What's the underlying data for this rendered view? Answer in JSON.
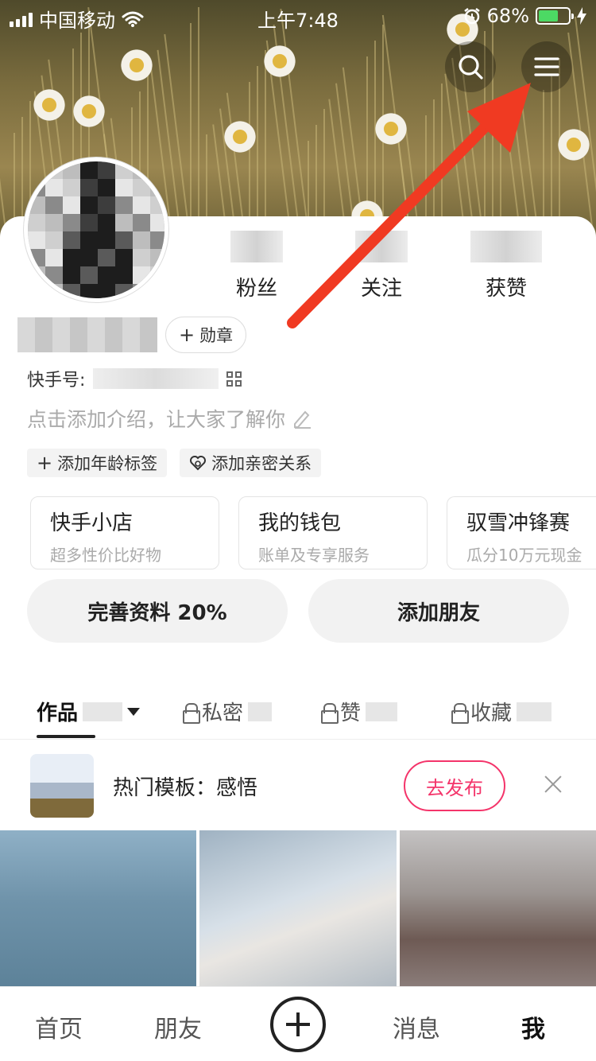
{
  "status_bar": {
    "carrier": "中国移动",
    "time": "上午7:48",
    "battery": "68%",
    "battery_level": 0.68,
    "alarm_icon": "alarm-clock-icon",
    "wifi_icon": "wifi-icon",
    "charging_icon": "charging-bolt-icon"
  },
  "header": {
    "search_icon": "search-icon",
    "menu_icon": "hamburger-menu-icon"
  },
  "stats": [
    {
      "label": "粉丝"
    },
    {
      "label": "关注"
    },
    {
      "label": "获赞"
    }
  ],
  "profile": {
    "medal_label": "勋章",
    "kuaishou_id_label": "快手号:",
    "intro_placeholder": "点击添加介绍，让大家了解你",
    "tags": [
      "添加年龄标签",
      "添加亲密关系"
    ]
  },
  "services": [
    {
      "title": "快手小店",
      "subtitle": "超多性价比好物"
    },
    {
      "title": "我的钱包",
      "subtitle": "账单及专享服务"
    },
    {
      "title": "驭雪冲锋赛",
      "subtitle": "瓜分10万元现金"
    }
  ],
  "actions": {
    "complete_profile": "完善资料 20%",
    "add_friends": "添加朋友"
  },
  "tabs": [
    {
      "label": "作品",
      "active": true
    },
    {
      "label": "私密",
      "locked": true
    },
    {
      "label": "赞",
      "locked": true
    },
    {
      "label": "收藏",
      "locked": true
    }
  ],
  "template_bar": {
    "text": "热门模板：感悟",
    "publish_label": "去发布"
  },
  "bottom_nav": {
    "home": "首页",
    "friends": "朋友",
    "messages": "消息",
    "me": "我"
  },
  "colors": {
    "accent": "#f4346a",
    "arrow": "#f03a22",
    "battery": "#4cd964"
  }
}
